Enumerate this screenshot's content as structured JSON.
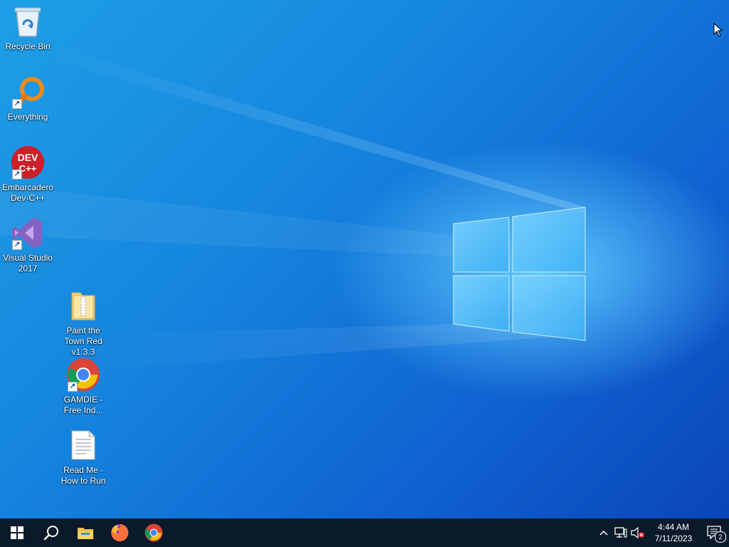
{
  "desktop": {
    "icons": [
      {
        "label": "Recycle Bin",
        "icon": "recycle-bin-icon"
      },
      {
        "label": "Everything",
        "icon": "everything-search-icon"
      },
      {
        "label": "Embarcadero Dev-C++",
        "icon": "dev-cpp-icon",
        "logo_text_1": "DEV",
        "logo_text_2": "C++"
      },
      {
        "label": "Visual Studio 2017",
        "icon": "visual-studio-icon"
      },
      {
        "label": "Paint the Town Red v1.3.3",
        "icon": "zip-folder-icon"
      },
      {
        "label": "GAMDIE - Free Ind...",
        "icon": "chrome-icon"
      },
      {
        "label": "Read Me - How to Run",
        "icon": "text-document-icon"
      }
    ]
  },
  "taskbar": {
    "pinned": [
      {
        "name": "start",
        "icon": "windows-start-icon"
      },
      {
        "name": "search",
        "icon": "search-icon"
      },
      {
        "name": "file-explorer",
        "icon": "file-explorer-icon"
      },
      {
        "name": "firefox",
        "icon": "firefox-icon"
      },
      {
        "name": "chrome",
        "icon": "chrome-icon"
      }
    ],
    "tray": {
      "time": "4:44 AM",
      "date": "7/11/2023",
      "notification_count": "2"
    }
  },
  "colors": {
    "taskbar_bg": "#0b1a2a",
    "desktop_accent": "#1584de"
  }
}
